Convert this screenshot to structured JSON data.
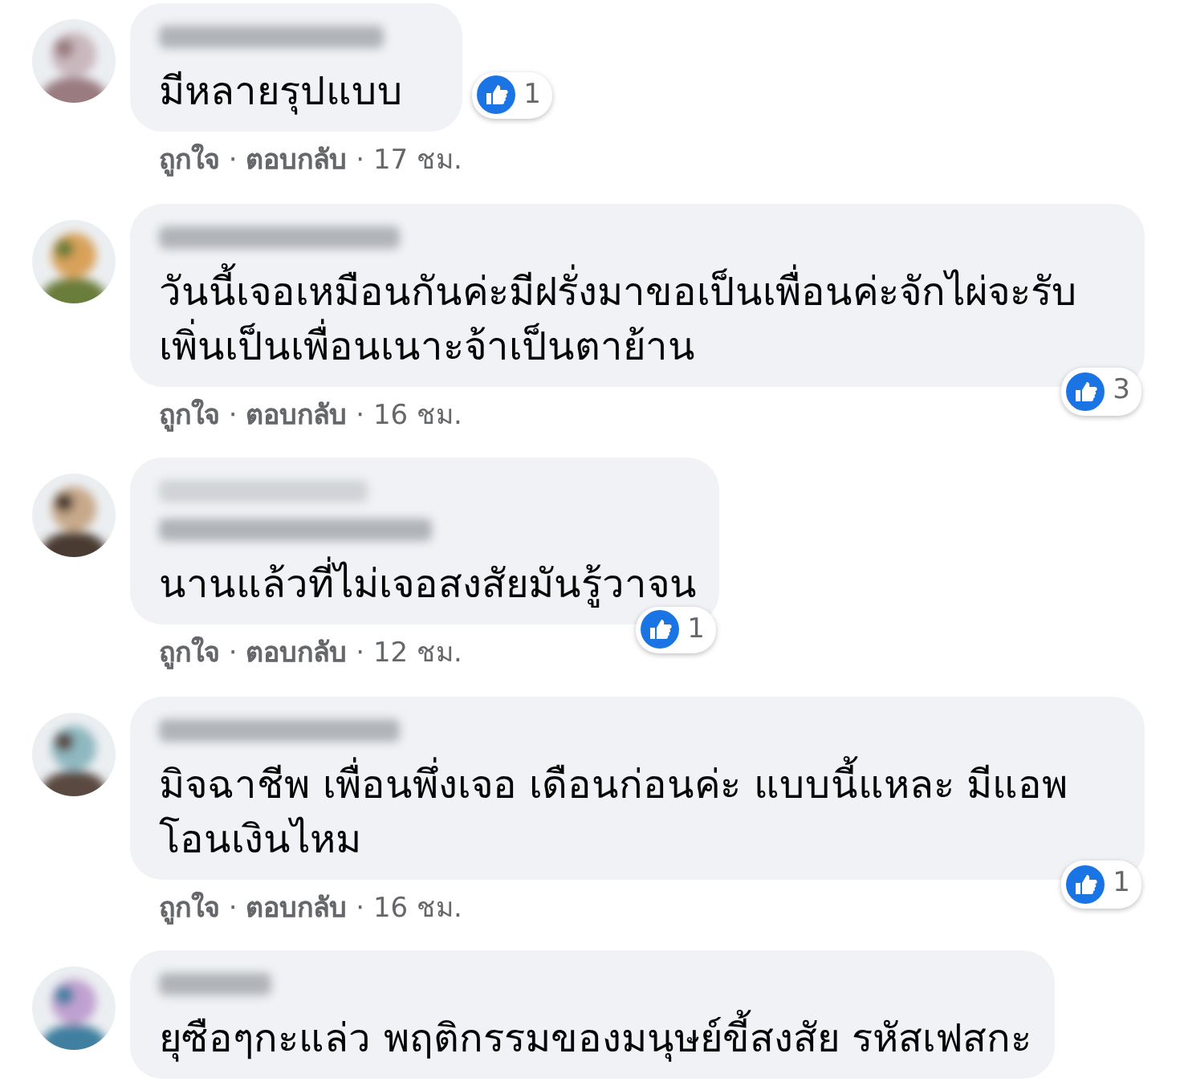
{
  "comments": [
    {
      "kind": "plain",
      "text": "มีหลายรุปแบบ",
      "reaction": {
        "count": "1"
      },
      "actions": [
        "ถูกใจ",
        "ตอบกลับ",
        "17 ชม."
      ],
      "separators": [
        "·",
        "·"
      ]
    },
    {
      "kind": "plain",
      "text": "วันนี้เจอเหมือนกันค่ะมีฝรั่งมาขอเป็นเพื่อนค่ะจักไผ่จะรับ เพิ่นเป็นเพื่อนเนาะจ้าเป็นตาย้าน",
      "reaction": {
        "count": "3"
      },
      "actions": [
        "ถูกใจ",
        "ตอบกลับ",
        "16 ชม."
      ],
      "separators": [
        "·",
        "·"
      ]
    },
    {
      "kind": "tagged",
      "text": "นานแล้วที่ไม่เจอสงสัยมันรู้วาจน",
      "reaction": {
        "count": "1"
      },
      "actions": [
        "ถูกใจ",
        "ตอบกลับ",
        "12 ชม."
      ],
      "separators": [
        "·",
        "·"
      ]
    },
    {
      "kind": "plain",
      "text": "มิจฉาชีพ เพื่อนพึ่งเจอ เดือนก่อนค่ะ แบบนี้แหละ มีแอพ โอนเงินไหม",
      "reaction": {
        "count": "1"
      },
      "actions": [
        "ถูกใจ",
        "ตอบกลับ",
        "16 ชม."
      ],
      "separators": [
        "·",
        "·"
      ]
    },
    {
      "kind": "plain",
      "text": "ยุซือๆกะแล่ว พฤติกรรมของมนุษย์ขี้สงสัย รหัสเฟสกะ"
    }
  ]
}
